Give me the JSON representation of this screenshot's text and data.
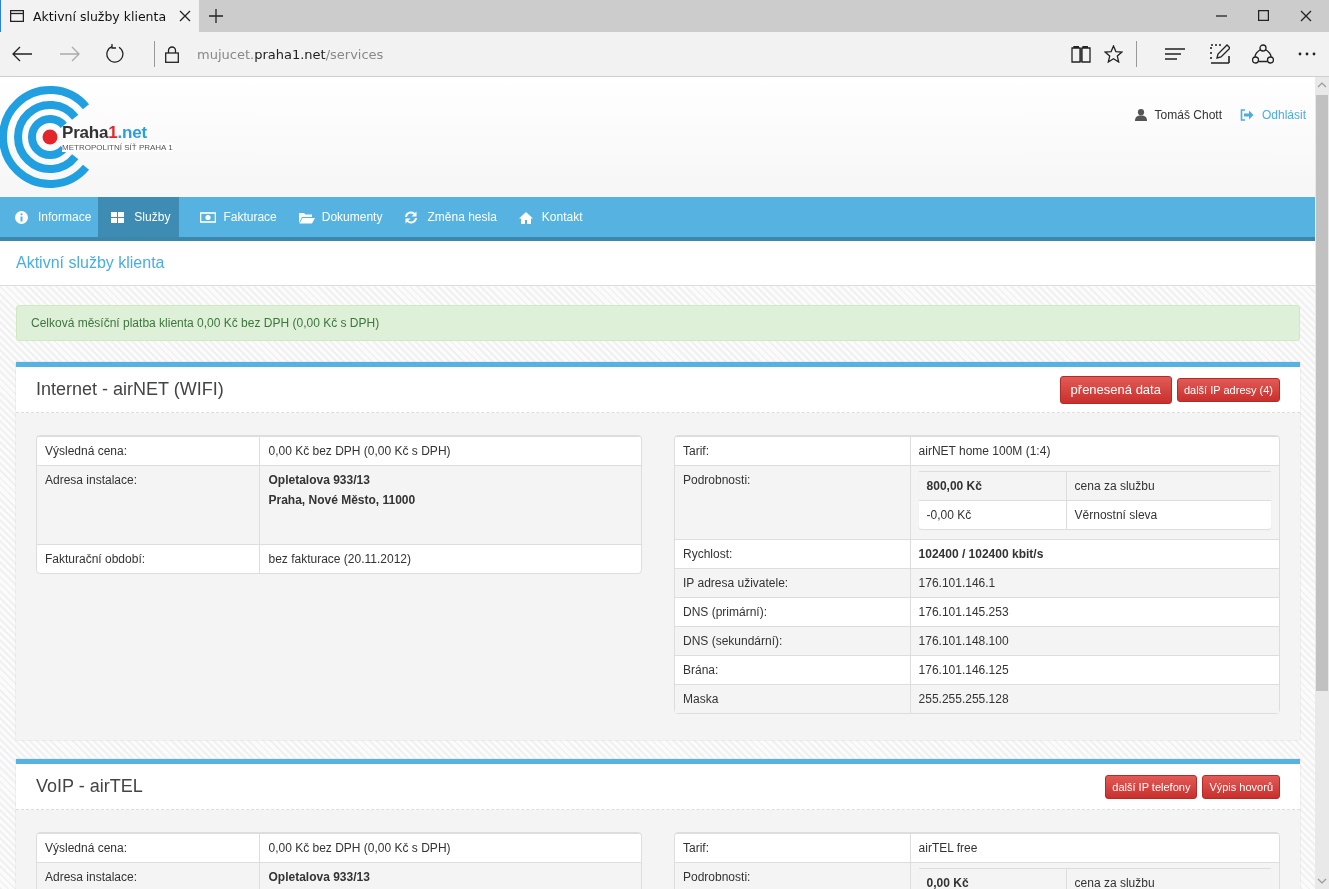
{
  "browser": {
    "tab_title": "Aktivní služby klienta",
    "url": {
      "prefix": "mujucet.",
      "domain": "praha1.net",
      "path": "/services"
    }
  },
  "header": {
    "brand": [
      "Praha",
      "1",
      ".net"
    ],
    "tagline": "METROPOLITNÍ SÍŤ PRAHA 1",
    "user": "Tomáš Chott",
    "logout": "Odhlásit"
  },
  "nav": [
    {
      "label": "Informace",
      "selected": false
    },
    {
      "label": "Služby",
      "selected": true
    },
    {
      "label": "Fakturace",
      "selected": false
    },
    {
      "label": "Dokumenty",
      "selected": false
    },
    {
      "label": "Změna hesla",
      "selected": false
    },
    {
      "label": "Kontakt",
      "selected": false
    }
  ],
  "page_title": "Aktivní služby klienta",
  "alert": "Celková měsíční platba klienta 0,00 Kč bez DPH (0,00 Kč s DPH)",
  "services": [
    {
      "title": "Internet - airNET (WIFI)",
      "buttons": [
        {
          "label": "přenesená data",
          "kind": "large"
        },
        {
          "label": "další IP adresy (4)",
          "kind": "small"
        }
      ],
      "left": [
        {
          "kind": "text",
          "label": "Výsledná cena:",
          "value": "0,00 Kč bez DPH (0,00 Kč s DPH)",
          "bold": false
        },
        {
          "kind": "lines",
          "label": "Adresa instalace:",
          "lines": [
            "Opletalova 933/13",
            "Praha, Nové Město, 11000"
          ],
          "bold": true
        },
        {
          "kind": "text",
          "label": "Fakturační období:",
          "value": "bez fakturace (20.11.2012)",
          "bold": false
        }
      ],
      "right": [
        {
          "kind": "text",
          "label": "Tarif:",
          "value": "airNET home 100M (1:4)",
          "bold": false
        },
        {
          "kind": "details",
          "label": "Podrobnosti:",
          "items": [
            {
              "amount": "800,00 Kč",
              "note": "cena za službu",
              "bold": true
            },
            {
              "amount": "-0,00 Kč",
              "note": "Věrnostní sleva",
              "bold": false
            }
          ]
        },
        {
          "kind": "text",
          "label": "Rychlost:",
          "value": "102400 / 102400 kbit/s",
          "bold": true
        },
        {
          "kind": "text",
          "label": "IP adresa uživatele:",
          "value": "176.101.146.1",
          "bold": false
        },
        {
          "kind": "text",
          "label": "DNS (primární):",
          "value": "176.101.145.253",
          "bold": false
        },
        {
          "kind": "text",
          "label": "DNS (sekundární):",
          "value": "176.101.148.100",
          "bold": false
        },
        {
          "kind": "text",
          "label": "Brána:",
          "value": "176.101.146.125",
          "bold": false
        },
        {
          "kind": "text",
          "label": "Maska",
          "value": "255.255.255.128",
          "bold": false
        }
      ]
    },
    {
      "title": "VoIP - airTEL",
      "buttons": [
        {
          "label": "další IP telefony",
          "kind": "small"
        },
        {
          "label": "Výpis hovorů",
          "kind": "small"
        }
      ],
      "left": [
        {
          "kind": "text",
          "label": "Výsledná cena:",
          "value": "0,00 Kč bez DPH (0,00 Kč s DPH)",
          "bold": false
        },
        {
          "kind": "lines",
          "label": "Adresa instalace:",
          "lines": [
            "Opletalova 933/13"
          ],
          "bold": true
        }
      ],
      "right": [
        {
          "kind": "text",
          "label": "Tarif:",
          "value": "airTEL free",
          "bold": false
        },
        {
          "kind": "details",
          "label": "Podrobnosti:",
          "items": [
            {
              "amount": "0,00 Kč",
              "note": "cena za službu",
              "bold": true
            }
          ]
        }
      ]
    }
  ]
}
